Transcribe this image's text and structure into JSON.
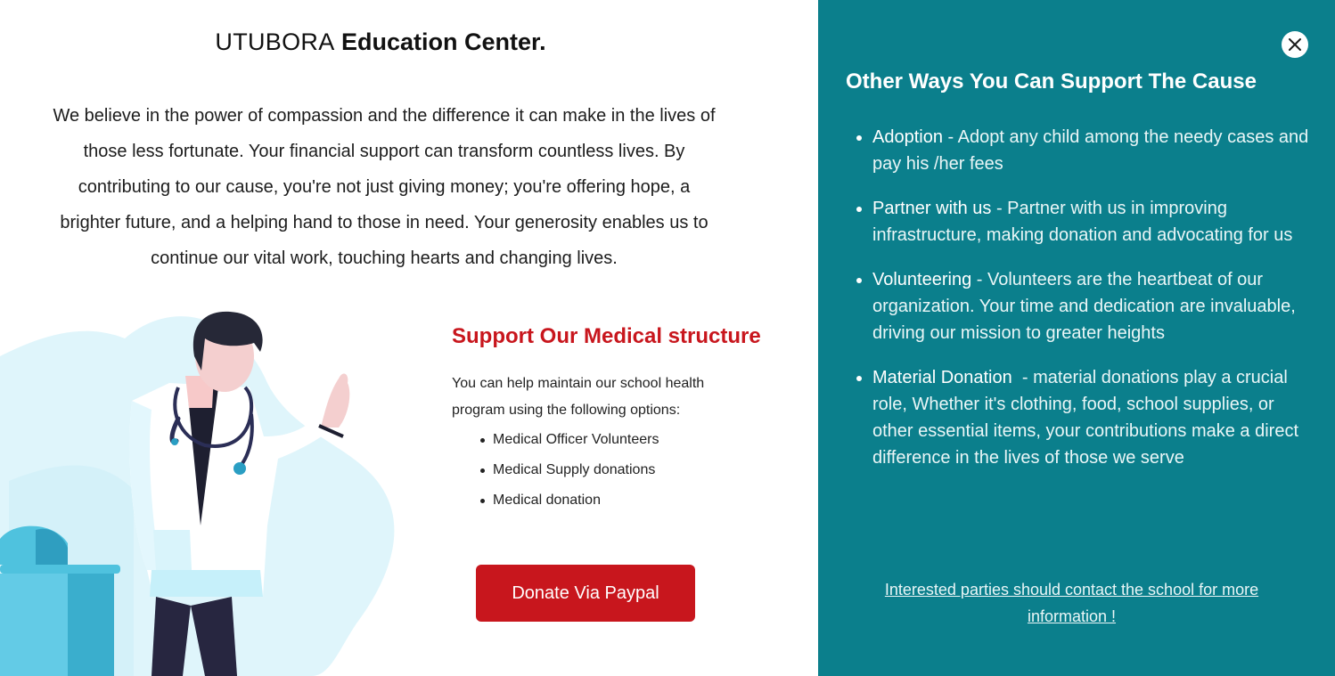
{
  "header": {
    "brand": "UTUBORA",
    "title_rest": "Education Center."
  },
  "intro": "We believe in the power of compassion and the difference it can make in the lives of those less fortunate. Your financial support can transform countless lives. By contributing to our cause, you're not just giving money; you're offering hope, a brighter future, and a helping hand to those in need. Your generosity enables us to continue our vital work, touching hearts and changing lives.",
  "medical": {
    "title": "Support Our Medical structure",
    "description": "You can help maintain our school health program using the following options:",
    "options": [
      "Medical Officer Volunteers",
      "Medical Supply donations",
      "Medical donation"
    ],
    "donate_label": "Donate Via Paypal"
  },
  "sidebar": {
    "title": "Other Ways You Can Support The Cause",
    "ways": [
      {
        "term": "Adoption",
        "separator": " - ",
        "text": "Adopt any child among the needy cases and pay his /her fees"
      },
      {
        "term": "Partner with us",
        "separator": " - ",
        "text": "Partner with us in improving infrastructure, making donation and advocating for us"
      },
      {
        "term": "Volunteering",
        "separator": " - ",
        "text": "Volunteers are the heartbeat of our organization. Your time and dedication are invaluable, driving our mission to greater heights"
      },
      {
        "term": "Material Donation",
        "separator": "  - ",
        "text": "material donations play a crucial role, Whether it's clothing, food, school supplies, or other essential items, your contributions make a direct difference in the lives of those we serve"
      }
    ],
    "contact_link": "Interested parties should contact the school for more information !"
  },
  "icons": {
    "close": "close-icon",
    "illustration": "doctor-illustration"
  },
  "colors": {
    "accent_red": "#c8161d",
    "panel_teal": "#0b7f8c"
  }
}
